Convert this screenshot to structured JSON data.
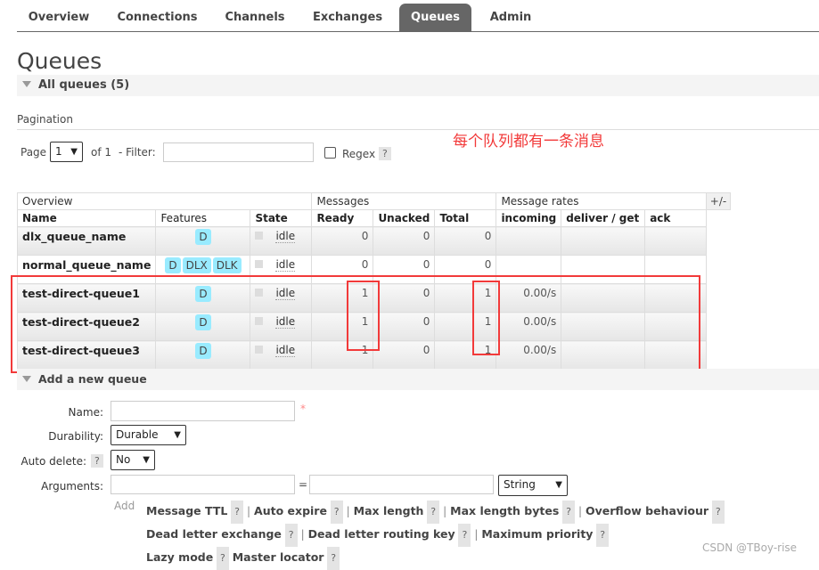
{
  "nav": {
    "tabs": [
      "Overview",
      "Connections",
      "Channels",
      "Exchanges",
      "Queues",
      "Admin"
    ],
    "active": "Queues"
  },
  "page_title": "Queues",
  "all_queues": "All queues (5)",
  "pagination": {
    "label": "Pagination",
    "page_label": "Page",
    "page_value": "1",
    "of_label": "of 1",
    "filter_label": "- Filter:",
    "filter_value": "",
    "regex_label": "Regex",
    "help": "?"
  },
  "annotation": "每个队列都有一条消息",
  "table": {
    "group_headers": [
      "Overview",
      "Messages",
      "Message rates"
    ],
    "plus_minus": "+/-",
    "columns": [
      "Name",
      "Features",
      "State",
      "Ready",
      "Unacked",
      "Total",
      "incoming",
      "deliver / get",
      "ack"
    ],
    "rows": [
      {
        "name": "dlx_queue_name",
        "features": [
          "D"
        ],
        "state": "idle",
        "ready": "0",
        "unacked": "0",
        "total": "0",
        "incoming": "",
        "deliver": "",
        "ack": ""
      },
      {
        "name": "normal_queue_name",
        "features": [
          "D",
          "DLX",
          "DLK"
        ],
        "state": "idle",
        "ready": "0",
        "unacked": "0",
        "total": "0",
        "incoming": "",
        "deliver": "",
        "ack": ""
      },
      {
        "name": "test-direct-queue1",
        "features": [
          "D"
        ],
        "state": "idle",
        "ready": "1",
        "unacked": "0",
        "total": "1",
        "incoming": "0.00/s",
        "deliver": "",
        "ack": ""
      },
      {
        "name": "test-direct-queue2",
        "features": [
          "D"
        ],
        "state": "idle",
        "ready": "1",
        "unacked": "0",
        "total": "1",
        "incoming": "0.00/s",
        "deliver": "",
        "ack": ""
      },
      {
        "name": "test-direct-queue3",
        "features": [
          "D"
        ],
        "state": "idle",
        "ready": "1",
        "unacked": "0",
        "total": "1",
        "incoming": "0.00/s",
        "deliver": "",
        "ack": ""
      }
    ]
  },
  "add_queue": {
    "title": "Add a new queue",
    "name_label": "Name:",
    "required": "*",
    "durability_label": "Durability:",
    "durability_value": "Durable",
    "auto_delete_label": "Auto delete:",
    "auto_delete_value": "No",
    "arguments_label": "Arguments:",
    "equals": "=",
    "type_value": "String",
    "add_label": "Add",
    "arg_links": [
      [
        "Message TTL",
        "Auto expire",
        "Max length",
        "Max length bytes",
        "Overflow behaviour"
      ],
      [
        "Dead letter exchange",
        "Dead letter routing key",
        "Maximum priority"
      ],
      [
        "Lazy mode",
        "Master locator"
      ]
    ]
  },
  "watermark": "CSDN @TBoy-rise",
  "colors": {
    "active_tab": "#666666",
    "badge": "#99ebff",
    "annotation": "#f23a3a"
  }
}
